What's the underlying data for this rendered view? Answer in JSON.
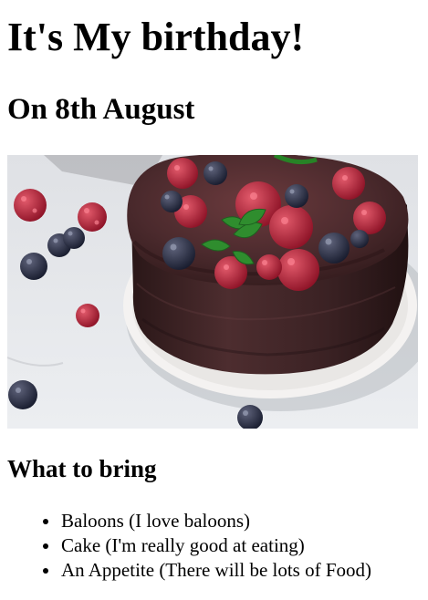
{
  "page": {
    "title": "It's My birthday!",
    "subtitle": "On 8th August",
    "image": {
      "subject": "chocolate cake with berries",
      "colors": {
        "background": "#e6e7ea",
        "chocolate": "#3a2424",
        "plate": "#f2f0ef",
        "raspberry": "#c72d46",
        "blueberry": "#24283e",
        "mint": "#2f8d2e"
      }
    },
    "section_heading": "What to bring",
    "bring_list": [
      "Baloons (I love baloons)",
      "Cake (I'm really good at eating)",
      "An Appetite (There will be lots of Food)"
    ]
  }
}
